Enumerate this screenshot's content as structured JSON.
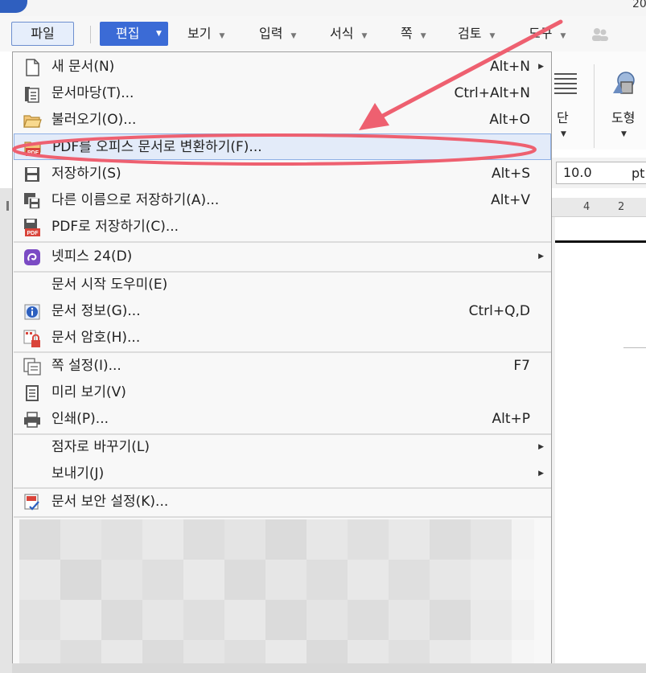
{
  "corner_text": "20",
  "menubar": {
    "file_label": "파일",
    "edit_label": "편집",
    "items": [
      {
        "label": "보기"
      },
      {
        "label": "입력"
      },
      {
        "label": "서식"
      },
      {
        "label": "쪽"
      },
      {
        "label": "검토"
      },
      {
        "label": "도구"
      }
    ]
  },
  "ribbon": {
    "columns_label": "단",
    "shape_label": "도형",
    "font_size_value": "10.0",
    "font_size_unit": "pt",
    "ruler_numbers": [
      "4",
      "2"
    ]
  },
  "file_menu": {
    "items": [
      {
        "label": "새 문서(N)",
        "shortcut": "Alt+N",
        "submenu": true,
        "icon": "new-document-icon"
      },
      {
        "label": "문서마당(T)...",
        "shortcut": "Ctrl+Alt+N",
        "icon": "document-template-icon"
      },
      {
        "label": "불러오기(O)...",
        "shortcut": "Alt+O",
        "icon": "open-folder-icon"
      },
      {
        "label": "PDF를 오피스 문서로 변환하기(F)...",
        "shortcut": "",
        "icon": "pdf-folder-icon",
        "highlighted": true
      },
      {
        "label": "저장하기(S)",
        "shortcut": "Alt+S",
        "icon": "save-icon"
      },
      {
        "label": "다른 이름으로 저장하기(A)...",
        "shortcut": "Alt+V",
        "icon": "save-as-icon"
      },
      {
        "label": "PDF로 저장하기(C)...",
        "shortcut": "",
        "icon": "save-pdf-icon"
      },
      {
        "label": "넷피스 24(D)",
        "shortcut": "",
        "submenu": true,
        "icon": "netffice-icon"
      },
      {
        "label": "문서 시작 도우미(E)",
        "shortcut": "",
        "icon": ""
      },
      {
        "label": "문서 정보(G)...",
        "shortcut": "Ctrl+Q,D",
        "icon": "info-icon"
      },
      {
        "label": "문서 암호(H)...",
        "shortcut": "",
        "icon": "lock-document-icon"
      },
      {
        "label": "쪽 설정(I)...",
        "shortcut": "F7",
        "icon": "page-setup-icon"
      },
      {
        "label": "미리 보기(V)",
        "shortcut": "",
        "icon": "preview-icon"
      },
      {
        "label": "인쇄(P)...",
        "shortcut": "Alt+P",
        "icon": "printer-icon"
      },
      {
        "label": "점자로 바꾸기(L)",
        "shortcut": "",
        "submenu": true,
        "icon": ""
      },
      {
        "label": "보내기(J)",
        "shortcut": "",
        "submenu": true,
        "icon": ""
      },
      {
        "label": "문서 보안 설정(K)...",
        "shortcut": "",
        "icon": "security-settings-icon"
      }
    ]
  },
  "colors": {
    "accent": "#3b6bd6",
    "highlight": "#e3ebf9",
    "annotation": "#ee6070"
  }
}
